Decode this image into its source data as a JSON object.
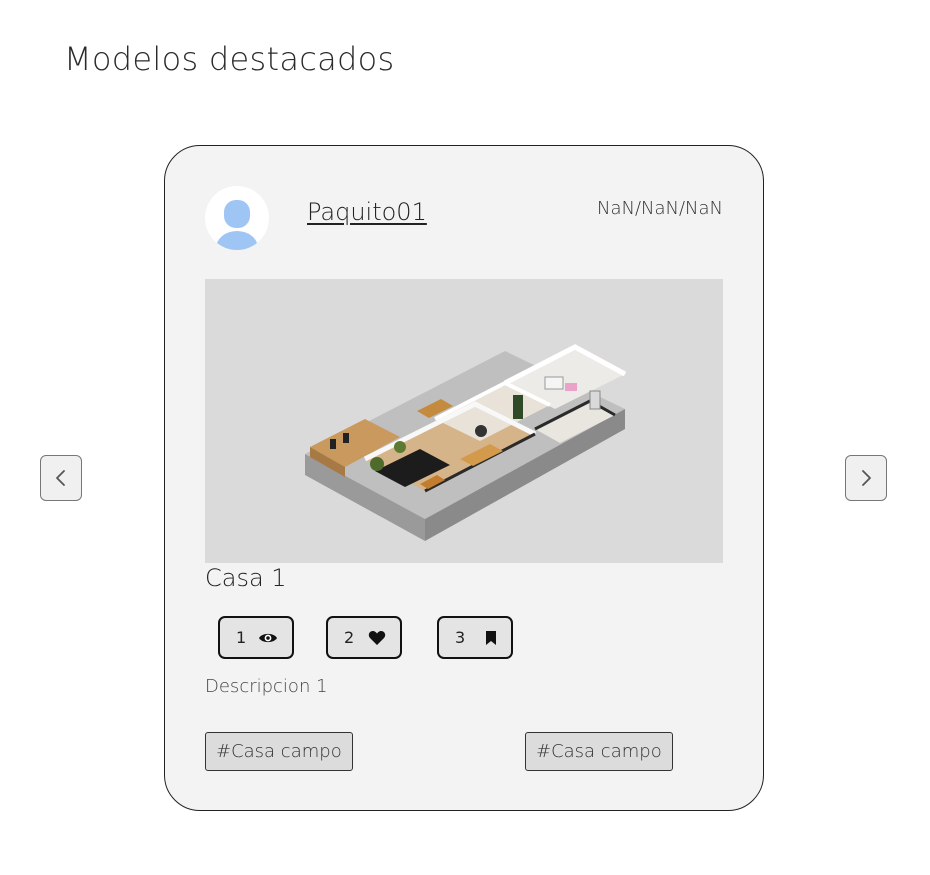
{
  "section": {
    "title": "Modelos destacados"
  },
  "carousel": {
    "card": {
      "username": "Paquito01",
      "date": "NaN/NaN/NaN",
      "title": "Casa 1",
      "stats": [
        {
          "value": "1",
          "icon": "eye-icon"
        },
        {
          "value": "2",
          "icon": "heart-icon"
        },
        {
          "value": "3",
          "icon": "bookmark-icon"
        }
      ],
      "description": "Descripcion 1",
      "tags": [
        "#Casa campo",
        "#Casa campo"
      ]
    }
  },
  "colors": {
    "card_background": "#f3f3f3",
    "avatar_accent": "#9fc5f5",
    "image_background": "#dadada"
  }
}
